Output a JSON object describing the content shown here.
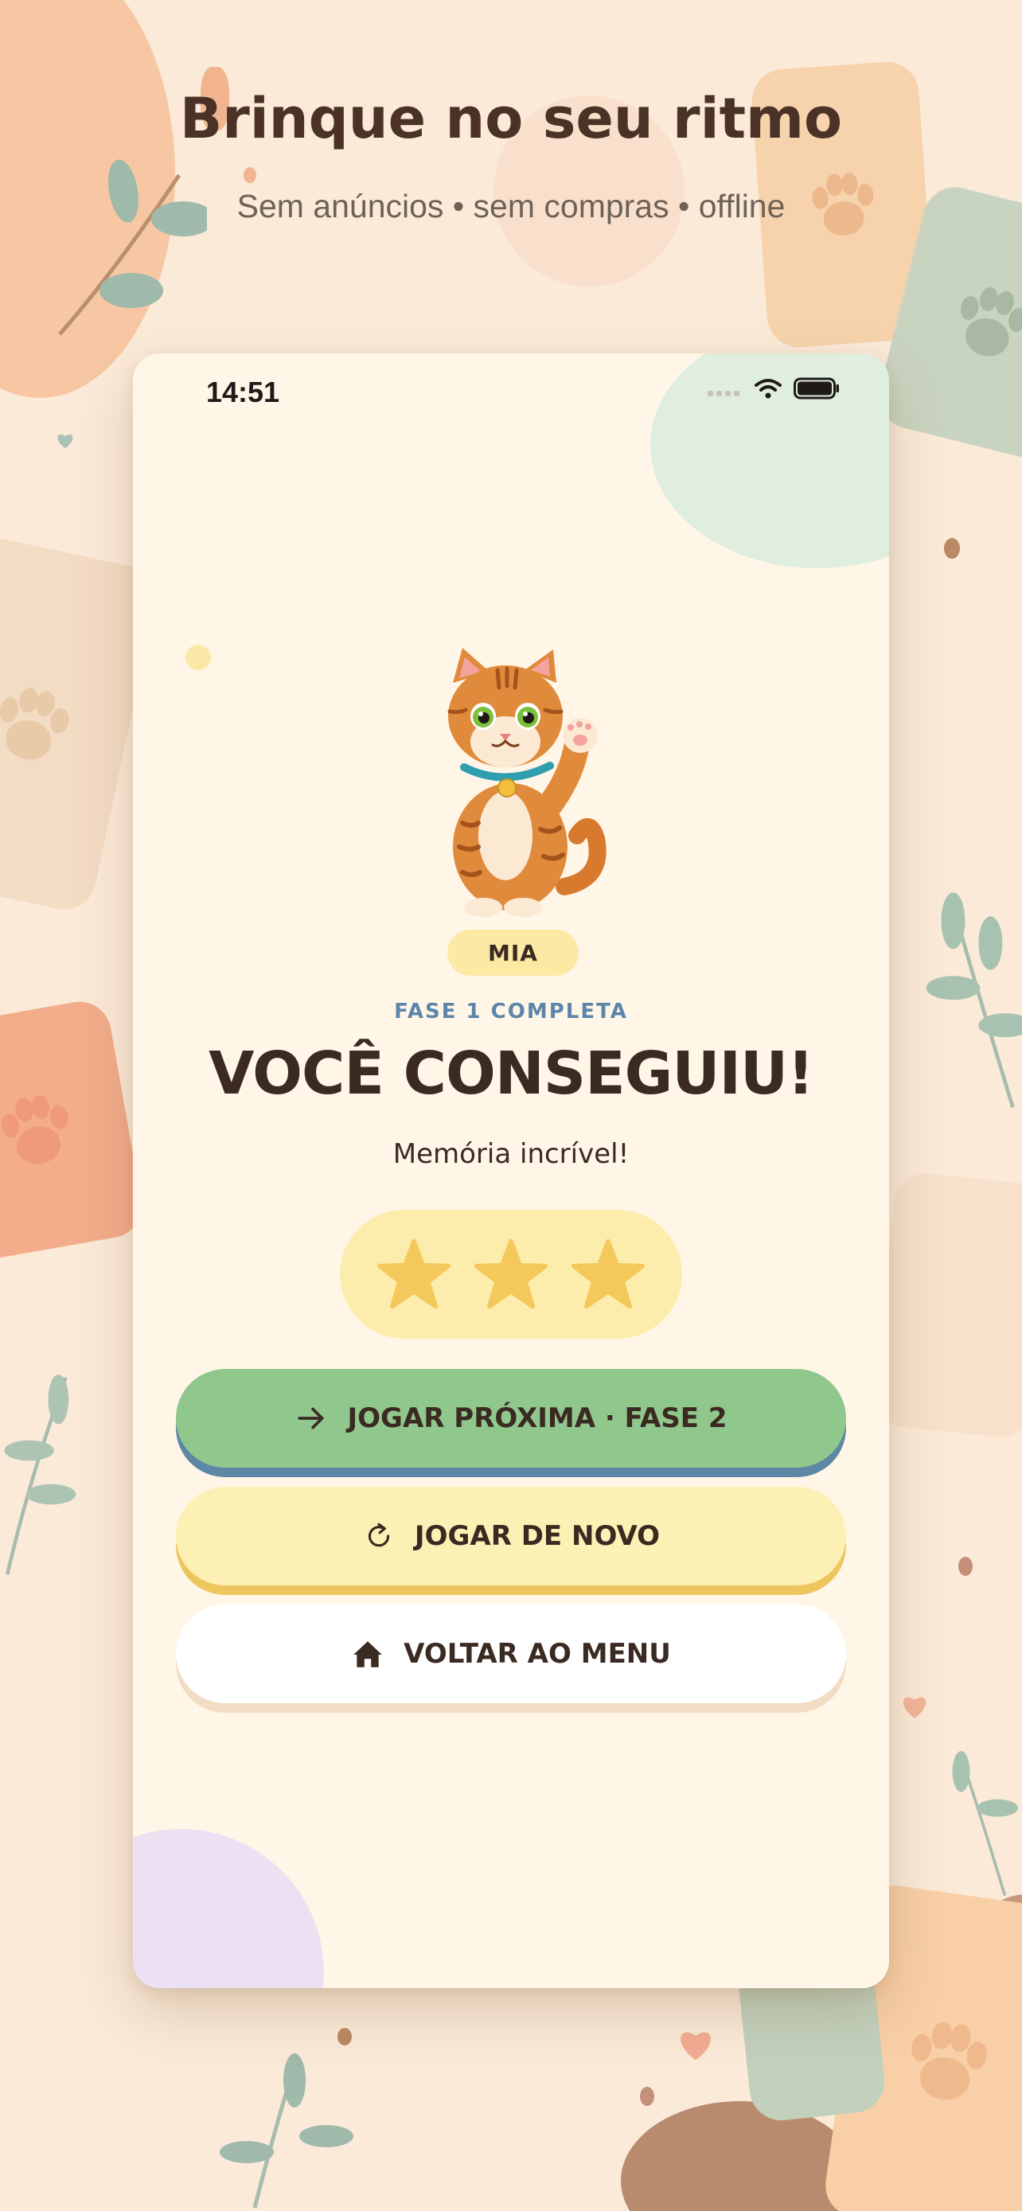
{
  "headline": "Brinque no seu ritmo",
  "subline": "Sem anúncios • sem compras • offline",
  "status_bar": {
    "time": "14:51",
    "icons": [
      "signal-icon",
      "wifi-icon",
      "battery-icon"
    ]
  },
  "character": {
    "name": "MIA",
    "icon": "waving-cat-illustration"
  },
  "level_label": "FASE 1 COMPLETA",
  "title": "VOCÊ CONSEGUIU!",
  "message": "Memória incrível!",
  "rating": {
    "stars_earned": 3,
    "stars_total": 3,
    "star_color": "#f5c85c"
  },
  "buttons": {
    "next": {
      "label": "JOGAR PRÓXIMA · FASE 2",
      "icon": "arrow-right-icon",
      "color": "#90c78c"
    },
    "again": {
      "label": "JOGAR DE NOVO",
      "icon": "restart-icon",
      "color": "#fdf0b5"
    },
    "menu": {
      "label": "VOLTAR AO MENU",
      "icon": "home-icon",
      "color": "#ffffff"
    }
  },
  "colors": {
    "background": "#fbead8",
    "card": "#fff6e8",
    "text_dark": "#3a2a22",
    "accent_blue": "#5b86aa"
  }
}
